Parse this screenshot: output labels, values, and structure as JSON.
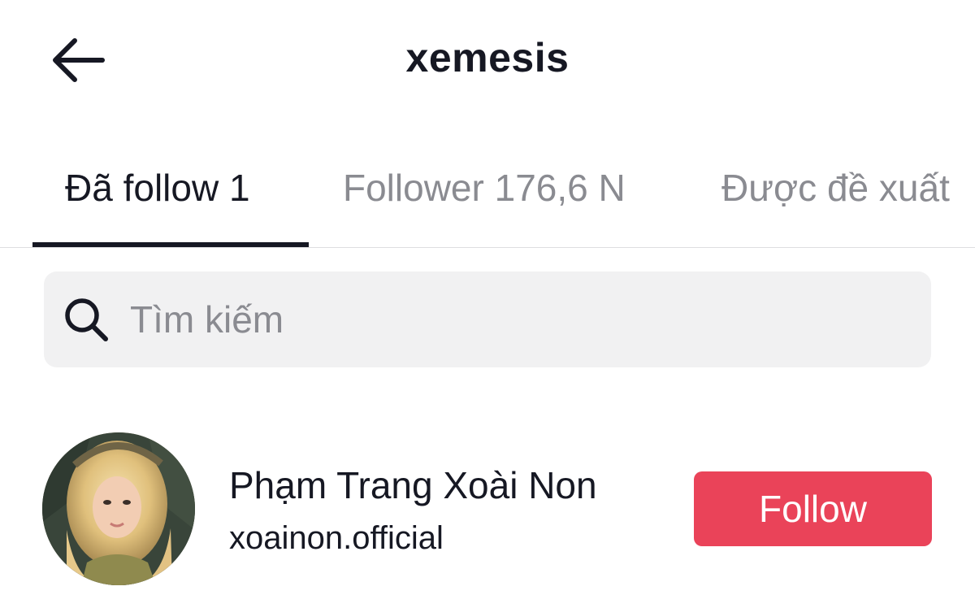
{
  "header": {
    "title": "xemesis",
    "back_icon": "arrow-left-icon"
  },
  "tabs": [
    {
      "label": "Đã follow 1",
      "active": true
    },
    {
      "label": "Follower 176,6 N",
      "active": false
    },
    {
      "label": "Được đề xuất",
      "active": false
    }
  ],
  "search": {
    "placeholder": "Tìm kiếm",
    "value": "",
    "icon": "search-icon"
  },
  "users": [
    {
      "name": "Phạm Trang Xoài Non",
      "handle": "xoainon.official",
      "button_label": "Follow"
    }
  ],
  "colors": {
    "follow_button": "#ea4359",
    "text_primary": "#161823",
    "text_secondary": "#8a8b91",
    "search_background": "#f1f1f2"
  }
}
